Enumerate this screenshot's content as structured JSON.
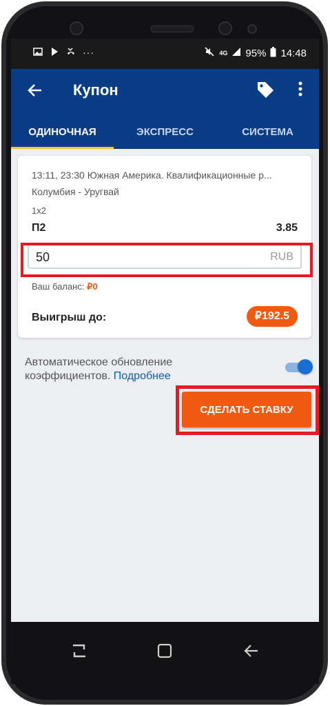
{
  "status_bar": {
    "left_icons": [
      "image-icon",
      "play-store-icon",
      "missed-call-icon",
      "more-dots-icon"
    ],
    "network": "4G",
    "battery": "95%",
    "time": "14:48"
  },
  "app_bar": {
    "title": "Купон"
  },
  "tabs": [
    {
      "label": "ОДИНОЧНАЯ",
      "active": true
    },
    {
      "label": "ЭКСПРЕСС",
      "active": false
    },
    {
      "label": "СИСТЕМА",
      "active": false
    }
  ],
  "coupon": {
    "event_line": "13:11, 23:30 Южная Америка. Квалификационные р...",
    "teams": "Колумбия - Уругвай",
    "market": "1x2",
    "outcome": "П2",
    "odds": "3.85",
    "amount_value": "50",
    "currency": "RUB",
    "balance_label": "Ваш баланс:",
    "balance_value": "₽0",
    "win_label": "Выигрыш до:",
    "win_value": "₽192.5"
  },
  "auto_update": {
    "text": "Автоматическое обновление коэффициентов.",
    "link": "Подробнее",
    "enabled": true
  },
  "bet_button": {
    "label": "СДЕЛАТЬ СТАВКУ"
  },
  "colors": {
    "primary": "#0b3d86",
    "accent": "#f05a12",
    "highlight": "#e31b23",
    "tab_indicator": "#f6c43a"
  }
}
